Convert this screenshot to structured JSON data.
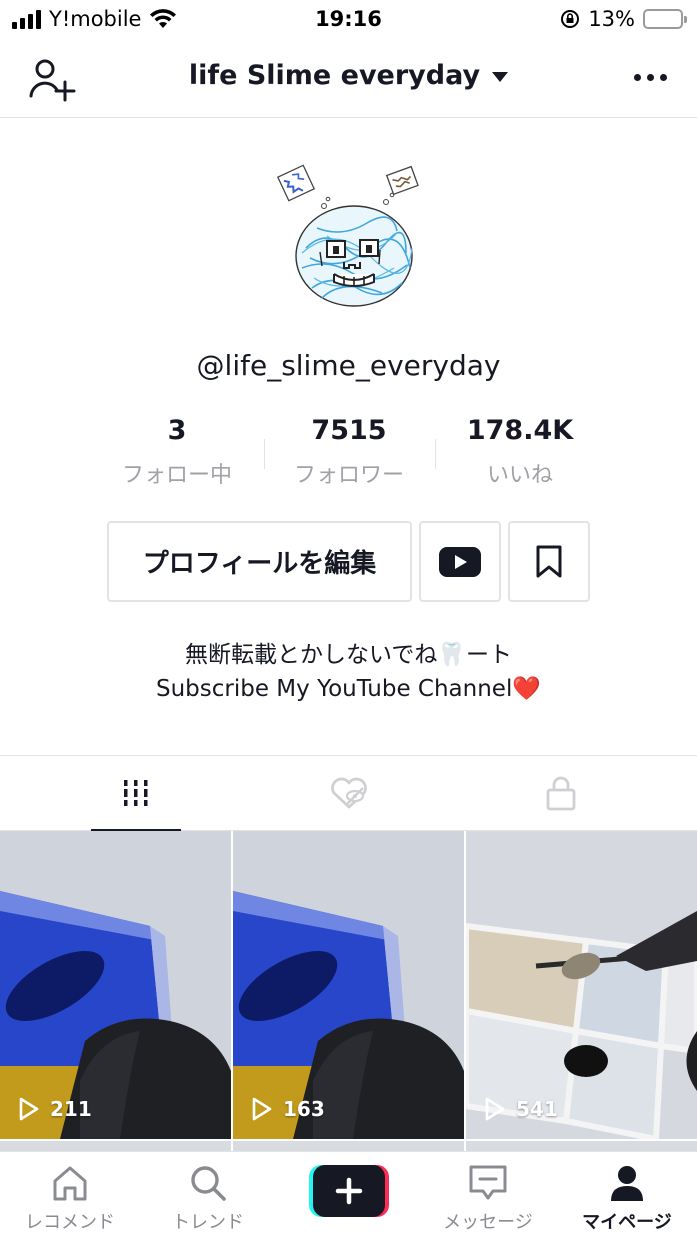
{
  "status_bar": {
    "carrier": "Y!mobile",
    "time": "19:16",
    "battery": "13%",
    "battery_level": 0.13
  },
  "nav": {
    "title": "life Slime everyday"
  },
  "profile": {
    "handle": "@life_slime_everyday",
    "stats": [
      {
        "value": "3",
        "label": "フォロー中"
      },
      {
        "value": "7515",
        "label": "フォロワー"
      },
      {
        "value": "178.4K",
        "label": "いいね"
      }
    ],
    "edit_label": "プロフィールを編集",
    "bio_line1": "無断転載とかしないでね🦷ート",
    "bio_line2": "Subscribe My YouTube Channel❤️"
  },
  "videos": [
    {
      "views": "211"
    },
    {
      "views": "163"
    },
    {
      "views": "541"
    }
  ],
  "tabbar": [
    {
      "label": "レコメンド"
    },
    {
      "label": "トレンド"
    },
    {
      "label": "メッセージ"
    },
    {
      "label": "マイページ"
    }
  ],
  "colors": {
    "accent_cyan": "#25f4ee",
    "accent_red": "#fe2c55",
    "text": "#161823",
    "muted": "#a1a2a7"
  }
}
